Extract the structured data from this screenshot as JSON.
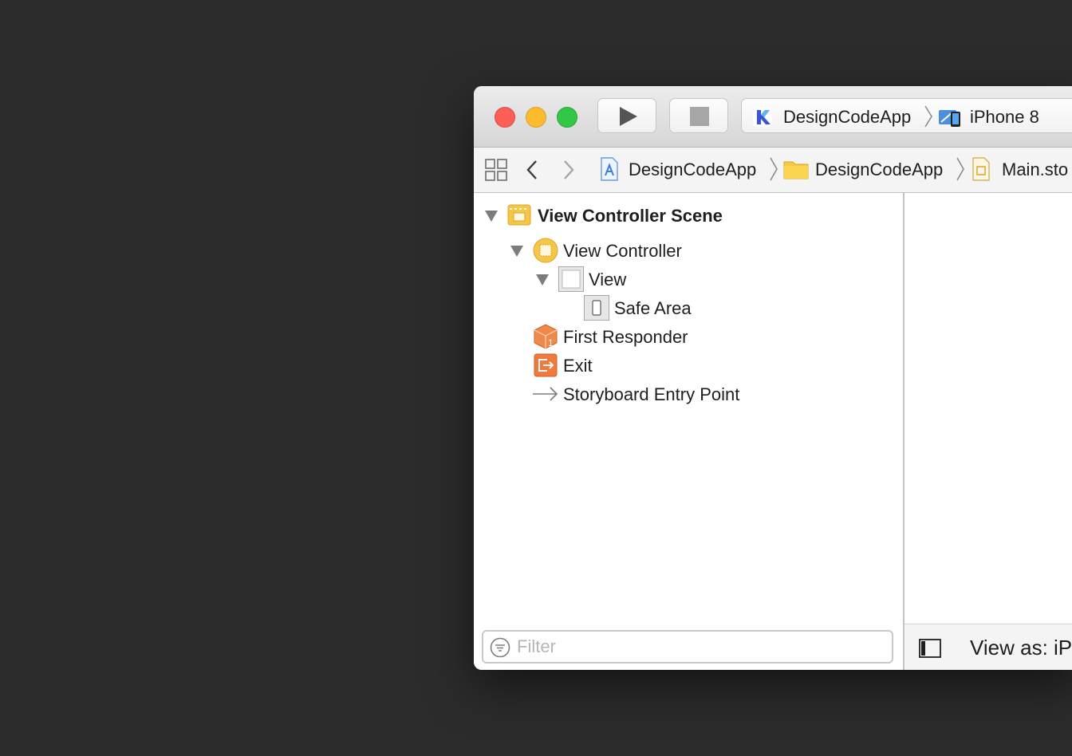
{
  "toolbar": {
    "run_label": "Run",
    "stop_label": "Stop",
    "scheme": {
      "app": "DesignCodeApp",
      "device": "iPhone 8"
    }
  },
  "jumpbar": {
    "crumbs": [
      "DesignCodeApp",
      "DesignCodeApp",
      "Main.sto"
    ]
  },
  "outline": {
    "items": [
      {
        "label": "View Controller Scene",
        "icon": "scene-icon",
        "expanded": true
      },
      {
        "label": "View Controller",
        "icon": "view-controller-icon",
        "expanded": true
      },
      {
        "label": "View",
        "icon": "view-icon",
        "expanded": true
      },
      {
        "label": "Safe Area",
        "icon": "safe-area-icon"
      },
      {
        "label": "First Responder",
        "icon": "first-responder-icon"
      },
      {
        "label": "Exit",
        "icon": "exit-icon"
      },
      {
        "label": "Storyboard Entry Point",
        "icon": "arrow-right-icon"
      }
    ],
    "filter_placeholder": "Filter"
  },
  "canvas": {
    "view_as": "View as: iP"
  },
  "colors": {
    "desktop": "#2c2c2c",
    "close": "#fc5f57",
    "minimize": "#fdbc2e",
    "zoom": "#33c748",
    "scene_yellow": "#f5c342",
    "responder_orange": "#ef8a4c"
  }
}
